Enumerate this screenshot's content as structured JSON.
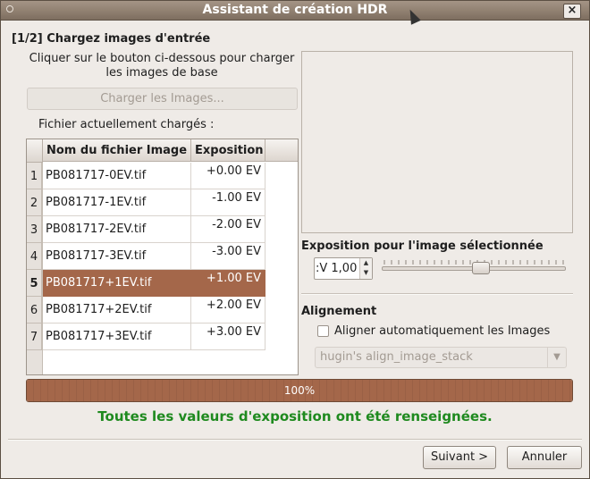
{
  "window": {
    "title": "Assistant de création HDR",
    "close_symbol": "×"
  },
  "step": {
    "title": "[1/2] Chargez images d'entrée",
    "instructions": "Cliquer sur le bouton ci-dessous pour charger les images de base",
    "load_button": "Charger les Images...",
    "files_label": "Fichier actuellement chargés :"
  },
  "table": {
    "columns": [
      "Nom du fichier Image",
      "Exposition"
    ],
    "rows": [
      {
        "num": "1",
        "name": "PB081717-0EV.tif",
        "exposure": "+0.00 EV"
      },
      {
        "num": "2",
        "name": "PB081717-1EV.tif",
        "exposure": "-1.00 EV"
      },
      {
        "num": "3",
        "name": "PB081717-2EV.tif",
        "exposure": "-2.00 EV"
      },
      {
        "num": "4",
        "name": "PB081717-3EV.tif",
        "exposure": "-3.00 EV"
      },
      {
        "num": "5",
        "name": "PB081717+1EV.tif",
        "exposure": "+1.00 EV",
        "selected": true
      },
      {
        "num": "6",
        "name": "PB081717+2EV.tif",
        "exposure": "+2.00 EV"
      },
      {
        "num": "7",
        "name": "PB081717+3EV.tif",
        "exposure": "+3.00 EV"
      }
    ]
  },
  "exposure": {
    "label": "Exposition pour l'image sélectionnée",
    "value": ":V 1,00",
    "spin_up": "▲",
    "spin_down": "▼",
    "slider_fraction": 0.54
  },
  "alignment": {
    "label": "Alignement",
    "checkbox_label": "Aligner automatiquement les Images",
    "checked": false,
    "combo_value": "hugin's align_image_stack",
    "combo_arrow": "▼"
  },
  "progress": {
    "text": "100%",
    "fraction": 1.0
  },
  "status": "Toutes les valeurs d'exposition ont été renseignées.",
  "buttons": {
    "next": "Suivant >",
    "cancel": "Annuler"
  },
  "colors": {
    "selection": "#a4674a",
    "status_green": "#1f8a1f",
    "titlebar": "#8f7f70"
  }
}
